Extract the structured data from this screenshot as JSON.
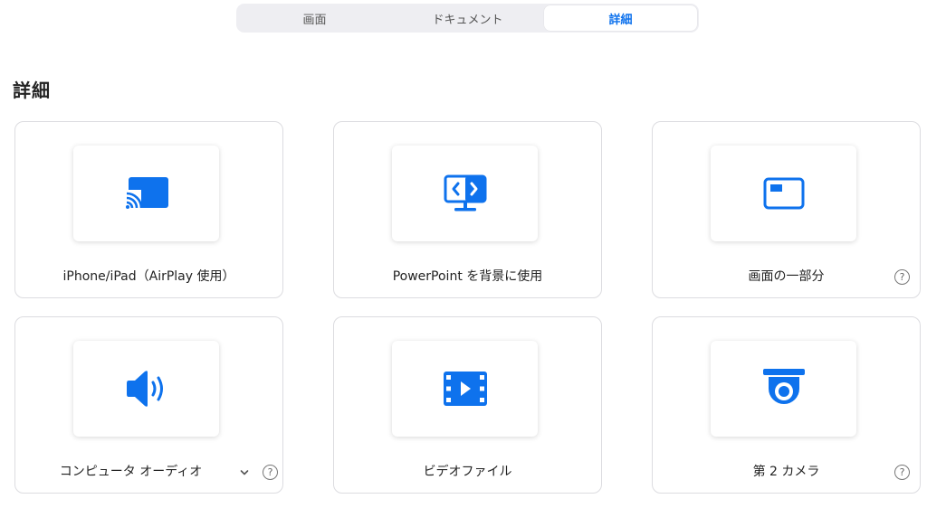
{
  "tabs": [
    {
      "label": "画面",
      "active": false
    },
    {
      "label": "ドキュメント",
      "active": false
    },
    {
      "label": "詳細",
      "active": true
    }
  ],
  "section_title": "詳細",
  "cards": [
    {
      "label": "iPhone/iPad（AirPlay 使用）",
      "icon": "airplay-cast-icon",
      "help": false
    },
    {
      "label": "PowerPoint を背景に使用",
      "icon": "powerpoint-monitor-icon",
      "help": false
    },
    {
      "label": "画面の一部分",
      "icon": "screen-portion-icon",
      "help": true
    },
    {
      "label": "コンピュータ オーディオ",
      "icon": "speaker-icon",
      "help": true,
      "dropdown": true
    },
    {
      "label": "ビデオファイル",
      "icon": "video-file-icon",
      "help": false
    },
    {
      "label": "第 2 カメラ",
      "icon": "camera-icon",
      "help": true
    }
  ],
  "help_glyph": "?",
  "colors": {
    "accent": "#0e72ed",
    "icon": "#0e72ed",
    "border": "#dcdce0",
    "tab_bg": "#eeeef2"
  }
}
